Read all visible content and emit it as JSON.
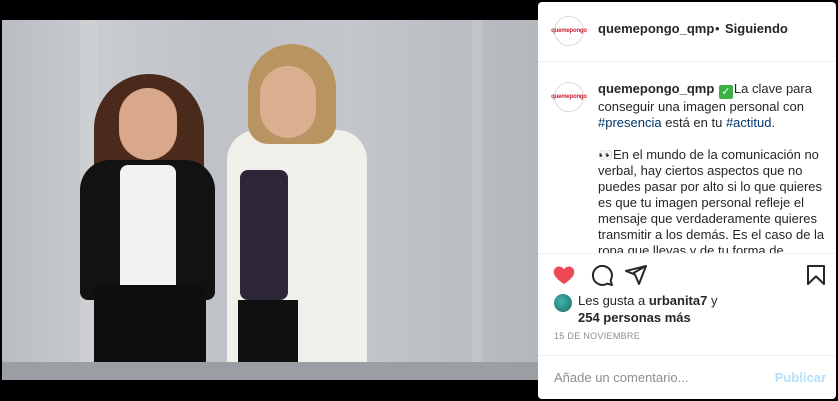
{
  "post": {
    "username": "quemepongo_qmp",
    "separator": "•",
    "follow_status": "Siguiendo",
    "more_label": "•••",
    "avatar_logo_text": "quemepongo"
  },
  "caption": {
    "username": "quemepongo_qmp",
    "check": "✓",
    "line1a": "La clave para conseguir una imagen personal con ",
    "tag1": "#presencia",
    "line1b": " está en tu ",
    "tag2": "#actitud",
    "line1c": ".",
    "eyes": "👀",
    "para2": "En el mundo de la comunicación no verbal, hay ciertos aspectos que no puedes pasar por alto si lo que quieres es que tu imagen personal refleje el mensaje que verdaderamente quieres transmitir a los demás. Es el caso de la ropa que llevas y de tu forma de"
  },
  "actions": {
    "like_icon": "heart-filled-icon",
    "comment_icon": "comment-icon",
    "share_icon": "paper-plane-icon",
    "save_icon": "bookmark-icon",
    "like_color": "#ed4956"
  },
  "likes": {
    "prefix": "Les gusta a ",
    "user": "urbanita7",
    "mid": " y",
    "count": "254 personas más"
  },
  "date": "15 DE NOVIEMBRE",
  "comment": {
    "placeholder": "Añade un comentario...",
    "publish_label": "Publicar"
  }
}
